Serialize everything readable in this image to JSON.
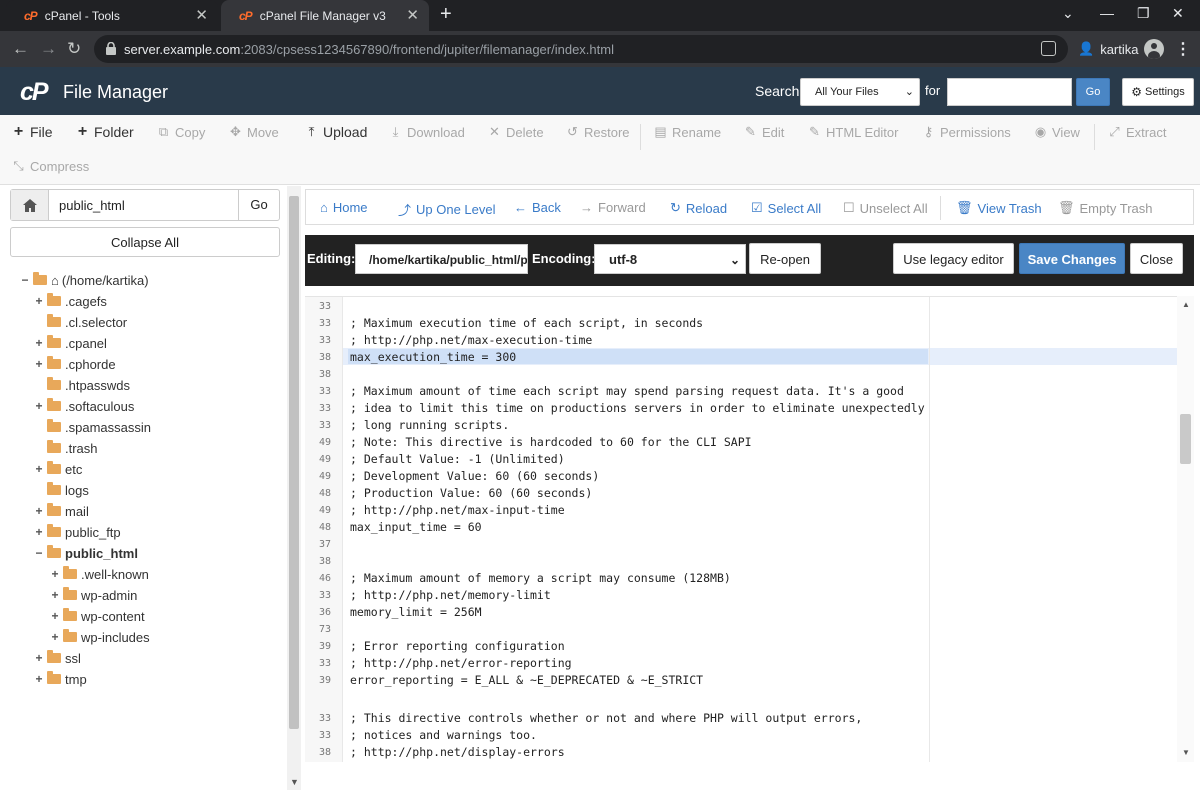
{
  "browser": {
    "tabs": [
      {
        "title": "cPanel - Tools",
        "active": false
      },
      {
        "title": "cPanel File Manager v3",
        "active": true
      }
    ],
    "url_host": "server.example.com",
    "url_path": ":2083/cpsess1234567890/frontend/jupiter/filemanager/index.html",
    "profile_name": "kartika"
  },
  "header": {
    "logo": "cP",
    "title": "File Manager",
    "search_label": "Search",
    "search_scope": "All Your Files",
    "for_label": "for",
    "search_value": "",
    "go_label": "Go",
    "settings_label": "Settings"
  },
  "toolbar": {
    "items": [
      {
        "label": "File",
        "icon": "plus-icon",
        "enabled": true
      },
      {
        "label": "Folder",
        "icon": "plus-icon",
        "enabled": true
      },
      {
        "label": "Copy",
        "icon": "copy-icon",
        "enabled": false
      },
      {
        "label": "Move",
        "icon": "move-icon",
        "enabled": false
      },
      {
        "label": "Upload",
        "icon": "upload-icon",
        "enabled": true
      },
      {
        "label": "Download",
        "icon": "download-icon",
        "enabled": false
      },
      {
        "label": "Delete",
        "icon": "delete-icon",
        "enabled": false
      },
      {
        "label": "Restore",
        "icon": "restore-icon",
        "enabled": false
      },
      {
        "label": "Rename",
        "icon": "rename-icon",
        "enabled": false
      },
      {
        "label": "Edit",
        "icon": "pencil-icon",
        "enabled": false
      },
      {
        "label": "HTML Editor",
        "icon": "html-editor-icon",
        "enabled": false
      },
      {
        "label": "Permissions",
        "icon": "key-icon",
        "enabled": false
      },
      {
        "label": "View",
        "icon": "eye-icon",
        "enabled": false
      },
      {
        "label": "Extract",
        "icon": "extract-icon",
        "enabled": false
      },
      {
        "label": "Compress",
        "icon": "compress-icon",
        "enabled": false
      }
    ]
  },
  "sidebar": {
    "path_value": "public_html",
    "go_label": "Go",
    "collapse_label": "Collapse All",
    "tree": [
      {
        "label": "(/home/kartika)",
        "toggle": "−",
        "home": true
      },
      {
        "label": ".cagefs",
        "toggle": "+"
      },
      {
        "label": ".cl.selector",
        "toggle": ""
      },
      {
        "label": ".cpanel",
        "toggle": "+"
      },
      {
        "label": ".cphorde",
        "toggle": "+"
      },
      {
        "label": ".htpasswds",
        "toggle": ""
      },
      {
        "label": ".softaculous",
        "toggle": "+"
      },
      {
        "label": ".spamassassin",
        "toggle": ""
      },
      {
        "label": ".trash",
        "toggle": ""
      },
      {
        "label": "etc",
        "toggle": "+"
      },
      {
        "label": "logs",
        "toggle": ""
      },
      {
        "label": "mail",
        "toggle": "+"
      },
      {
        "label": "public_ftp",
        "toggle": "+"
      },
      {
        "label": "public_html",
        "toggle": "−",
        "bold": true
      },
      {
        "label": ".well-known",
        "toggle": "+"
      },
      {
        "label": "wp-admin",
        "toggle": "+"
      },
      {
        "label": "wp-content",
        "toggle": "+"
      },
      {
        "label": "wp-includes",
        "toggle": "+"
      },
      {
        "label": "ssl",
        "toggle": "+"
      },
      {
        "label": "tmp",
        "toggle": "+"
      }
    ]
  },
  "navbar": {
    "items": [
      {
        "label": "Home",
        "icon": "home-icon",
        "enabled": true
      },
      {
        "label": "Up One Level",
        "icon": "up-level-icon",
        "enabled": true
      },
      {
        "label": "Back",
        "icon": "arrow-left-icon",
        "enabled": true
      },
      {
        "label": "Forward",
        "icon": "arrow-right-icon",
        "enabled": false
      },
      {
        "label": "Reload",
        "icon": "reload-icon",
        "enabled": true
      },
      {
        "label": "Select All",
        "icon": "checkbox-checked-icon",
        "enabled": true
      },
      {
        "label": "Unselect All",
        "icon": "checkbox-empty-icon",
        "enabled": false
      },
      {
        "label": "View Trash",
        "icon": "trash-icon",
        "enabled": true
      },
      {
        "label": "Empty Trash",
        "icon": "trash-icon",
        "enabled": false
      }
    ]
  },
  "editor": {
    "editing_label": "Editing:",
    "file_path": "/home/kartika/public_html/php.ini",
    "encoding_label": "Encoding:",
    "encoding_value": "utf-8",
    "reopen_label": "Re-open",
    "legacy_label": "Use legacy editor",
    "save_label": "Save Changes",
    "close_label": "Close",
    "lines": [
      {
        "n": "33",
        "text": ""
      },
      {
        "n": "33",
        "text": "; Maximum execution time of each script, in seconds"
      },
      {
        "n": "33",
        "text": "; http://php.net/max-execution-time"
      },
      {
        "n": "38",
        "text": "max_execution_time = 300"
      },
      {
        "n": "38",
        "text": ""
      },
      {
        "n": "33",
        "text": "; Maximum amount of time each script may spend parsing request data. It's a good"
      },
      {
        "n": "33",
        "text": "; idea to limit this time on productions servers in order to eliminate unexpectedly"
      },
      {
        "n": "33",
        "text": "; long running scripts."
      },
      {
        "n": "49",
        "text": "; Note: This directive is hardcoded to 60 for the CLI SAPI"
      },
      {
        "n": "49",
        "text": "; Default Value: -1 (Unlimited)"
      },
      {
        "n": "49",
        "text": "; Development Value: 60 (60 seconds)"
      },
      {
        "n": "48",
        "text": "; Production Value: 60 (60 seconds)"
      },
      {
        "n": "49",
        "text": "; http://php.net/max-input-time"
      },
      {
        "n": "48",
        "text": "max_input_time = 60"
      },
      {
        "n": "37",
        "text": ""
      },
      {
        "n": "38",
        "text": ""
      },
      {
        "n": "46",
        "text": "; Maximum amount of memory a script may consume (128MB)"
      },
      {
        "n": "33",
        "text": "; http://php.net/memory-limit"
      },
      {
        "n": "36",
        "text": "memory_limit = 256M"
      },
      {
        "n": "73",
        "text": ""
      },
      {
        "n": "39",
        "text": "; Error reporting configuration"
      },
      {
        "n": "33",
        "text": "; http://php.net/error-reporting"
      },
      {
        "n": "39",
        "text": "error_reporting = E_ALL & ~E_DEPRECATED & ~E_STRICT"
      },
      {
        "n": "",
        "text": ""
      },
      {
        "n": "33",
        "text": "; This directive controls whether or not and where PHP will output errors,"
      },
      {
        "n": "33",
        "text": "; notices and warnings too."
      },
      {
        "n": "38",
        "text": "; http://php.net/display-errors"
      }
    ]
  }
}
